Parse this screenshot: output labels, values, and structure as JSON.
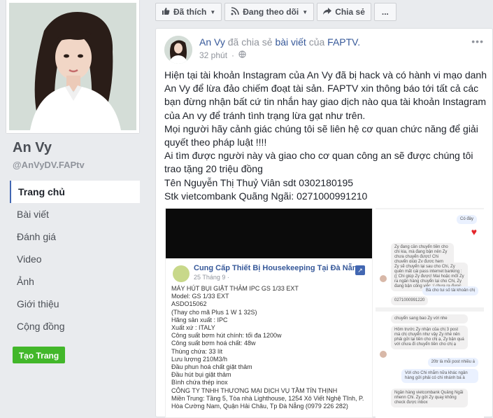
{
  "profile": {
    "name": "An Vy",
    "handle": "@AnVyDV.FAPtv"
  },
  "nav": [
    {
      "label": "Trang chủ",
      "active": true
    },
    {
      "label": "Bài viết",
      "active": false
    },
    {
      "label": "Đánh giá",
      "active": false
    },
    {
      "label": "Video",
      "active": false
    },
    {
      "label": "Ảnh",
      "active": false
    },
    {
      "label": "Giới thiệu",
      "active": false
    },
    {
      "label": "Cộng đồng",
      "active": false
    }
  ],
  "create_page_label": "Tạo Trang",
  "actions": {
    "like": "Đã thích",
    "follow": "Đang theo dõi",
    "share": "Chia sẻ",
    "more": "..."
  },
  "post": {
    "author": "An Vy",
    "shared_text": "đã chia sẻ",
    "shared_link": "bài viết",
    "of_text": "của",
    "page": "FAPTV.",
    "time": "32 phút",
    "paragraphs": [
      "Hiện tại tài khoản Instagram của An Vy đã bị hack và có hành vi mạo danh An Vy để lừa đảo chiếm đoạt tài sản. FAPTV xin thông báo tới tất cả các bạn đừng nhận bất cứ tin nhắn hay giao dịch nào qua tài khoản Instagram của An vy để tránh tình trạng lừa gạt như trên.",
      "Mọi người hãy cảnh giác chúng tôi sẽ liên hệ cơ quan chức năng để giải quyết theo pháp luật !!!!",
      "Ai tìm được người này và giao cho cơ quan công an sẽ được chúng tôi trao tặng 20 triệu đồng",
      "Tên Nguyễn Thị Thuỷ Viân sdt 0302180195",
      "Stk vietcombank Quãng Ngãi: 0271000991210"
    ]
  },
  "card": {
    "title": "Cung Cấp Thiết Bị Housekeeping Tại Đà Nẵng",
    "date": "25 Tháng 9 ·",
    "lines": [
      "MÁY HÚT BỤI GIẶT THẢM IPC GS 1/33 EXT",
      "Model: GS 1/33 EXT",
      "ASDO15062",
      "(Thay cho mã Plus 1 W 1 32S)",
      "Hãng sản xuất : IPC",
      "Xuất xứ : ITALY",
      "Công suất bơm hút chính: tối đa 1200w",
      "Công suất bơm hoá chất: 48w",
      "Thùng chứa: 33 lít",
      "Lưu lượng 210M3/h",
      "Đầu phun hoá chất giặt thảm",
      "Đầu hút bụi giặt thảm",
      "Bình chứa thép inox",
      "CÔNG TY TNHH THƯƠNG MẠI DỊCH VỤ TẦM TÍN THỊNH",
      "Miền Trung: Tầng 5, Tòa nhà Lighthouse, 1254 Xô Viết Nghệ Tĩnh, P.",
      "Hòa Cường Nam, Quận Hải Châu, Tp Đà Nẵng (0979 226 282)"
    ]
  },
  "chat": [
    {
      "text": "Có đây",
      "me": true
    },
    {
      "text": "Zy đang cần chuyển tiền cho chi kia, mà đang bận nên Zy chưa chuyển được! Chi chuyển giùp Zy được hem",
      "me": false
    },
    {
      "text": "Zy sẽ chuyển lại sau cho Chi, Zy quên mất cái pass internet banking :(( Chi giúp Zy được! Mai hoặc mốt Zy ra ngân hàng chuyển lại cho Chi, Zy đang bận công việc :( chưa ra được",
      "me": false
    },
    {
      "text": "Bà cho tui số tài khoản chị",
      "me": true
    },
    {
      "text": "0271000991220",
      "me": false
    },
    {
      "text": "chuyển sang bao Zy với nhe",
      "me": false
    },
    {
      "text": "Hôm trước Zy nhận của chị 3 post mà chị chuyển như vậy Zy nhé nên phải gửi lại tiền cho chị ạ, Zy bận quá với chưa đi chuyển tiền cho chị ạ",
      "me": false
    },
    {
      "text": "20tr là mỗi post nhiều á",
      "me": true
    },
    {
      "text": "Với cho Chi nhắm nữa khác ngân hàng gửi phải có chi nhánh bá à",
      "me": true
    },
    {
      "text": "Ngân hàng vietcombank Quảng Ngãi nhenn Chi. Zy gửi Zy quay không check được inbox",
      "me": false
    }
  ]
}
